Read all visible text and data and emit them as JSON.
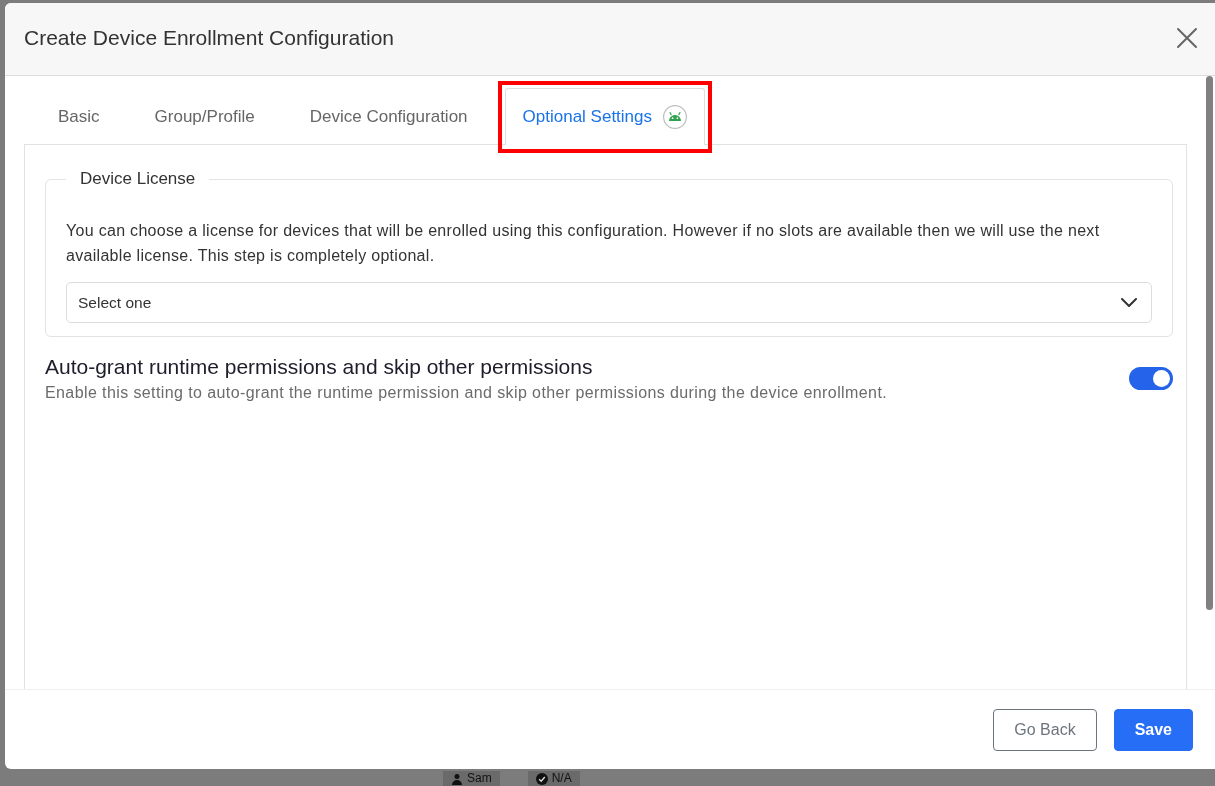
{
  "dialog": {
    "title": "Create Device Enrollment Configuration"
  },
  "tabs": [
    {
      "label": "Basic",
      "selected": false,
      "highlighted": false,
      "icon": false
    },
    {
      "label": "Group/Profile",
      "selected": false,
      "highlighted": false,
      "icon": false
    },
    {
      "label": "Device Configuration",
      "selected": false,
      "highlighted": false,
      "icon": false
    },
    {
      "label": "Optional Settings",
      "selected": true,
      "highlighted": true,
      "icon": true
    }
  ],
  "license": {
    "legend": "Device License",
    "description": "You can choose a license for devices that will be enrolled using this configuration. However if no slots are available then we will use the next available license. This step is completely optional.",
    "select": {
      "value": "Select one"
    }
  },
  "settings": [
    {
      "kind": "switch",
      "title": "Auto-grant runtime permissions and skip other permissions",
      "description": "Enable this setting to auto-grant the runtime permission and skip other permissions during the device enrollment.",
      "on": true
    }
  ],
  "buttons": [
    {
      "label": "Go Back",
      "kind": "secondary"
    },
    {
      "label": "Save",
      "kind": "primary"
    }
  ],
  "background_chips": [
    {
      "kind": "user",
      "text": "Sam"
    },
    {
      "kind": "status",
      "text": "N/A"
    }
  ]
}
